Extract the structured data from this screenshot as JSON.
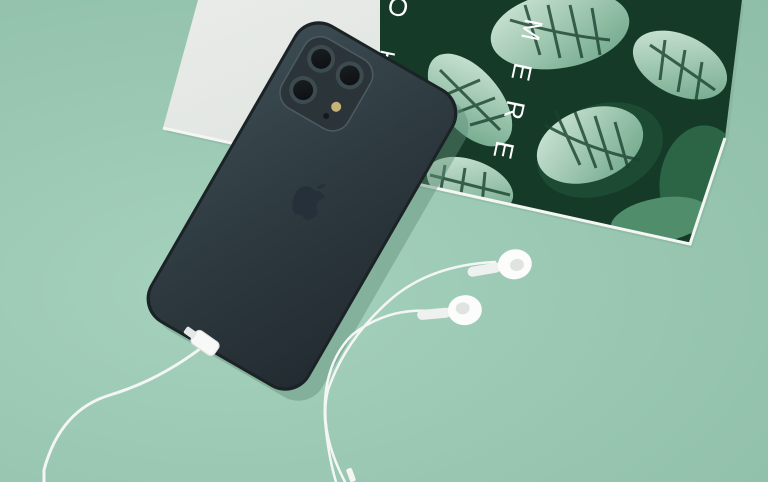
{
  "scene": {
    "description_colors": {
      "background": "#9cc9b4",
      "phone_body": "#2e3a3f",
      "earphones": "#f5f7f6",
      "leaf_dark": "#1f4a34",
      "leaf_light": "#cfe6d6"
    },
    "magazine_letters": [
      "O",
      "T",
      "M",
      "E",
      "R",
      "E"
    ],
    "icons": [
      "apple-logo-icon",
      "camera-lens-icon"
    ]
  }
}
